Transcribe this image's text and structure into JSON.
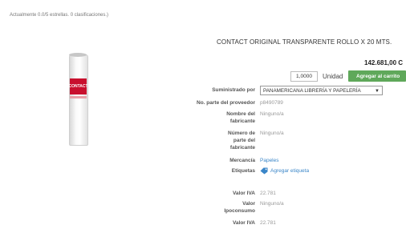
{
  "rating_text": "Actualmente 0.0/5 estrellas. 0 clasificaciones.)",
  "product": {
    "title": "CONTACT ORIGINAL TRANSPARENTE ROLLO X 20 MTS.",
    "price": "142.681,00 C",
    "image_brand": "CONTACT"
  },
  "purchase": {
    "quantity": "1,0000",
    "unit": "Unidad",
    "add_to_cart": "Agregar al carrito"
  },
  "details": {
    "supplied_by_label": "Suministrado por",
    "supplied_by_value": "PANAMERICANA LIBRERÍA Y PAPELERÍA",
    "supplier_part_label": "No. parte del proveedor",
    "supplier_part_value": "p8490789",
    "manufacturer_name_label": "Nombre del fabricante",
    "manufacturer_name_value": "Ninguno/a",
    "manufacturer_part_label": "Número de parte del fabricante",
    "manufacturer_part_value": "Ninguno/a",
    "merchandise_label": "Mercancía",
    "merchandise_value": "Papeles",
    "tags_label": "Etiquetas",
    "tags_value": "Agregar etiqueta",
    "iva_label": "Valor IVA",
    "iva_value": "22.781",
    "ipoconsumo_label": "Valor Ipoconsumo",
    "ipoconsumo_value": "Ninguno/a",
    "iva2_label": "Valor IVA",
    "iva2_value": "22.781"
  },
  "icons": {
    "tag": "tag-icon",
    "chevron": "chevron-down-icon"
  },
  "colors": {
    "add_button": "#5fa85a",
    "link": "#3a86c8",
    "brand_label": "#c8102e"
  }
}
